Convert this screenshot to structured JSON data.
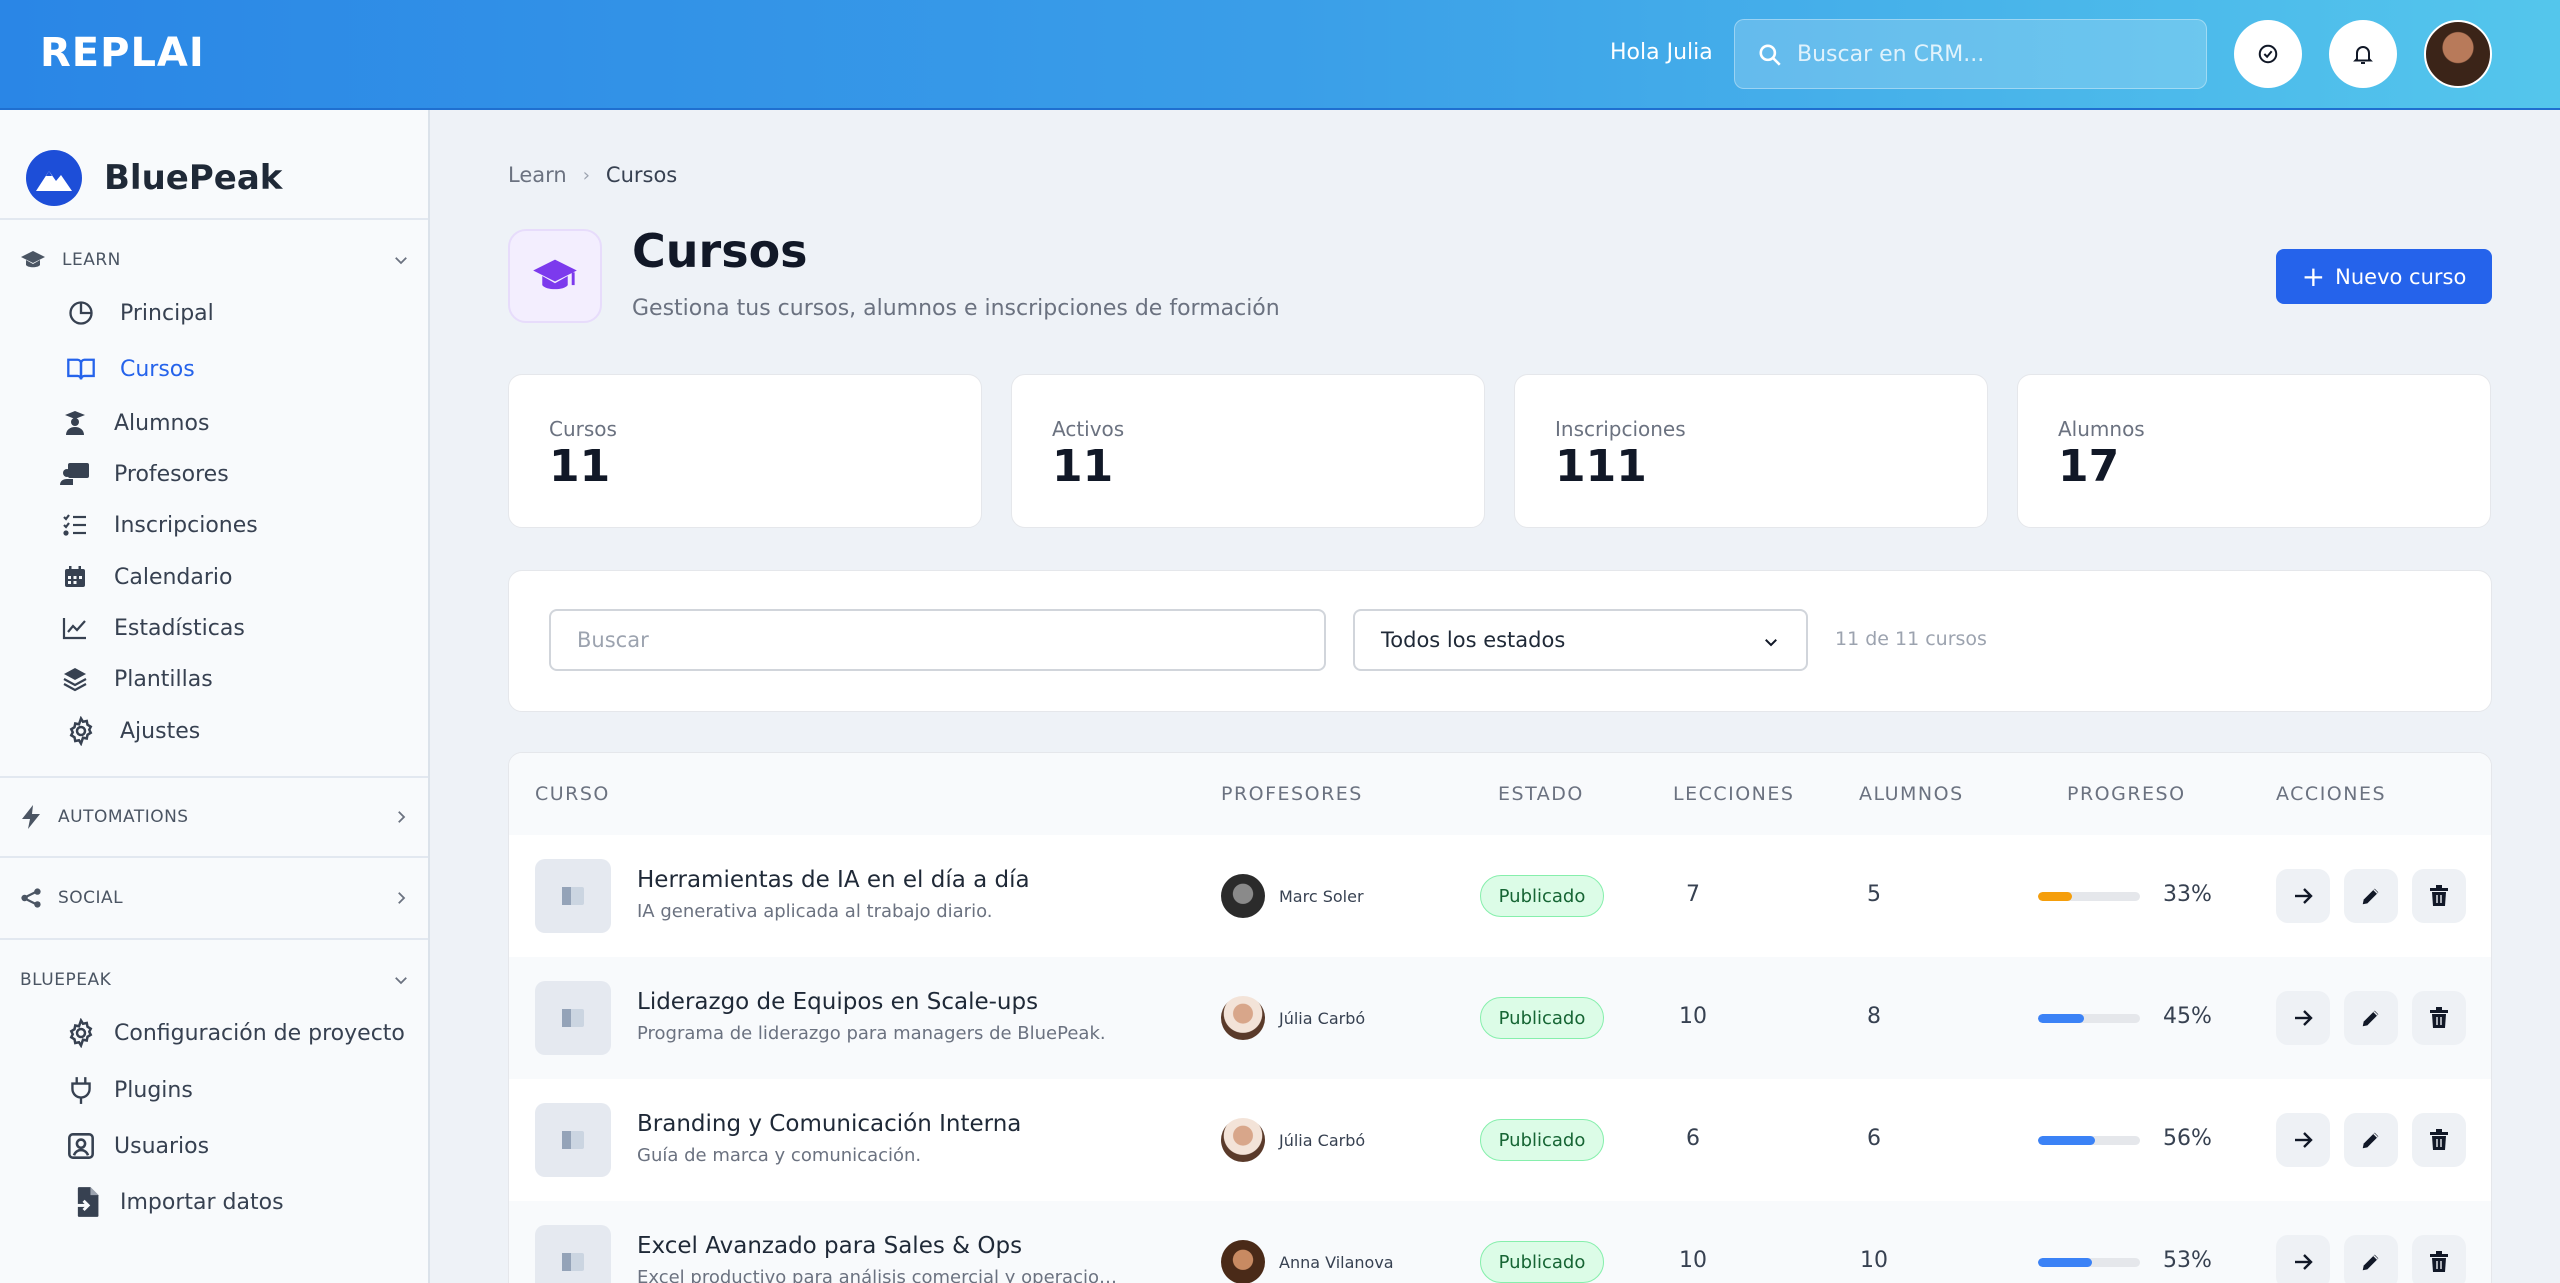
{
  "topbar": {
    "logo": "REPLAI",
    "greeting": "Hola Julia",
    "search_placeholder": "Buscar en CRM..."
  },
  "sidebar": {
    "brand": "BluePeak",
    "sections": [
      {
        "label": "LEARN"
      },
      {
        "label": "AUTOMATIONS"
      },
      {
        "label": "SOCIAL"
      },
      {
        "label": "BLUEPEAK"
      }
    ],
    "learn_items": [
      {
        "label": "Principal",
        "icon": "pie-chart-icon"
      },
      {
        "label": "Cursos",
        "icon": "book-open-icon",
        "active": true
      },
      {
        "label": "Alumnos",
        "icon": "student-icon"
      },
      {
        "label": "Profesores",
        "icon": "teacher-icon"
      },
      {
        "label": "Inscripciones",
        "icon": "list-check-icon"
      },
      {
        "label": "Calendario",
        "icon": "calendar-icon"
      },
      {
        "label": "Estadísticas",
        "icon": "line-chart-icon"
      },
      {
        "label": "Plantillas",
        "icon": "layers-icon"
      },
      {
        "label": "Ajustes",
        "icon": "gear-icon"
      }
    ],
    "bluepeak_items": [
      {
        "label": "Configuración de proyecto",
        "icon": "gear-icon"
      },
      {
        "label": "Plugins",
        "icon": "plug-icon"
      },
      {
        "label": "Usuarios",
        "icon": "user-square-icon"
      },
      {
        "label": "Importar datos",
        "icon": "file-import-icon"
      }
    ]
  },
  "breadcrumb": {
    "root": "Learn",
    "current": "Cursos"
  },
  "page": {
    "title": "Cursos",
    "subtitle": "Gestiona tus cursos, alumnos e inscripciones de formación",
    "new_button": "Nuevo curso"
  },
  "stats": [
    {
      "label": "Cursos",
      "value": "11"
    },
    {
      "label": "Activos",
      "value": "11"
    },
    {
      "label": "Inscripciones",
      "value": "111"
    },
    {
      "label": "Alumnos",
      "value": "17"
    }
  ],
  "filters": {
    "search_placeholder": "Buscar",
    "status_selected": "Todos los estados",
    "count_text": "11 de 11 cursos"
  },
  "table": {
    "headers": {
      "course": "CURSO",
      "teachers": "PROFESORES",
      "status": "ESTADO",
      "lessons": "LECCIONES",
      "students": "ALUMNOS",
      "progress": "PROGRESO",
      "actions": "ACCIONES"
    },
    "rows": [
      {
        "title": "Herramientas de IA en el día a día",
        "desc": "IA generativa aplicada al trabajo diario.",
        "teacher": "Marc Soler",
        "status": "Publicado",
        "lessons": "7",
        "students": "5",
        "progress": 33,
        "progress_text": "33%",
        "bar_color": "#f59e0b"
      },
      {
        "title": "Liderazgo de Equipos en Scale-ups",
        "desc": "Programa de liderazgo para managers de BluePeak.",
        "teacher": "Júlia Carbó",
        "status": "Publicado",
        "lessons": "10",
        "students": "8",
        "progress": 45,
        "progress_text": "45%",
        "bar_color": "#3b82f6"
      },
      {
        "title": "Branding y Comunicación Interna",
        "desc": "Guía de marca y comunicación.",
        "teacher": "Júlia Carbó",
        "status": "Publicado",
        "lessons": "6",
        "students": "6",
        "progress": 56,
        "progress_text": "56%",
        "bar_color": "#3b82f6"
      },
      {
        "title": "Excel Avanzado para Sales & Ops",
        "desc": "Excel productivo para análisis comercial y operacion...",
        "teacher": "Anna Vilanova",
        "status": "Publicado",
        "lessons": "10",
        "students": "10",
        "progress": 53,
        "progress_text": "53%",
        "bar_color": "#3b82f6"
      }
    ]
  },
  "colors": {
    "accent": "#2563eb",
    "topbar_start": "#2a86e6",
    "topbar_end": "#54c6ec",
    "badge_bg": "#dcfce7",
    "badge_text": "#166534"
  }
}
